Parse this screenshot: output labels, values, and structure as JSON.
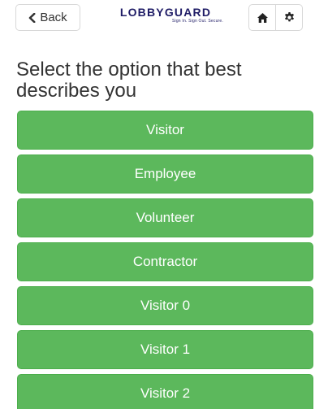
{
  "header": {
    "back_label": "Back",
    "logo": {
      "wordmark": "LOBBYGUARD",
      "tagline": "Sign In. Sign Out. Secure."
    },
    "home_icon": "home-icon",
    "settings_icon": "gear-icon"
  },
  "prompt": "Select the option that best describes you",
  "options": [
    {
      "label": "Visitor"
    },
    {
      "label": "Employee"
    },
    {
      "label": "Volunteer"
    },
    {
      "label": "Contractor"
    },
    {
      "label": "Visitor 0"
    },
    {
      "label": "Visitor 1"
    },
    {
      "label": "Visitor 2"
    }
  ],
  "colors": {
    "option_bg": "#5cb85c",
    "option_text": "#ffffff",
    "logo": "#1f1c66",
    "text": "#333333"
  }
}
